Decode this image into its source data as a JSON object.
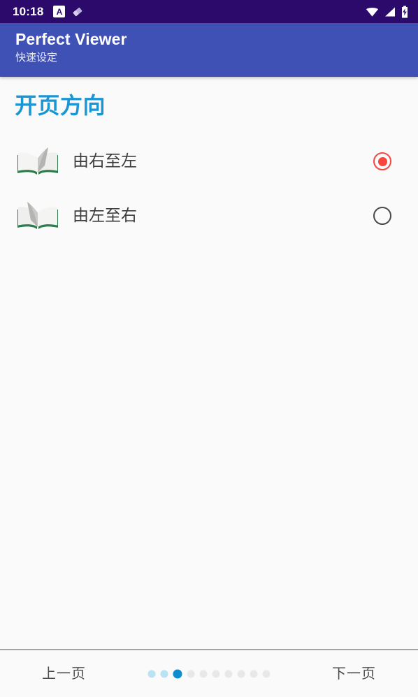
{
  "status_bar": {
    "clock": "10:18",
    "left_icons": [
      {
        "name": "a-badge-icon",
        "glyph": "A"
      },
      {
        "name": "eraser-icon",
        "glyph": ""
      }
    ],
    "right_icons": [
      {
        "name": "wifi-icon"
      },
      {
        "name": "cellular-signal-icon"
      },
      {
        "name": "battery-charging-icon"
      }
    ],
    "background": "#2b0a6b"
  },
  "app_bar": {
    "title": "Perfect Viewer",
    "subtitle": "快速设定",
    "background": "#3f51b5"
  },
  "main": {
    "section_title": "开页方向",
    "section_title_color": "#1a96d4",
    "options": [
      {
        "label": "由右至左",
        "icon": "book-open-right-to-left-icon",
        "selected": true
      },
      {
        "label": "由左至右",
        "icon": "book-open-left-to-right-icon",
        "selected": false
      }
    ],
    "radio_selected_color": "#f8463f",
    "radio_unselected_color": "#4a4a4a"
  },
  "bottom_bar": {
    "prev_label": "上一页",
    "next_label": "下一页",
    "pager": {
      "total": 10,
      "active_index": 3,
      "visited_count": 2,
      "active_color": "#0d8ecf",
      "visited_color": "#b9e2f3",
      "inactive_color": "#e8e8e8"
    }
  }
}
